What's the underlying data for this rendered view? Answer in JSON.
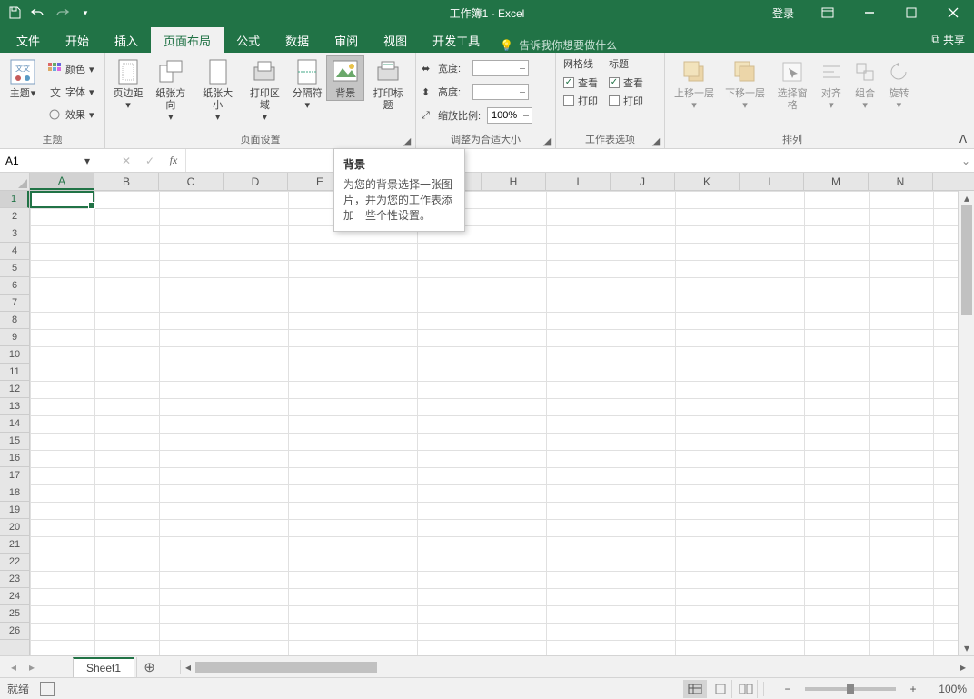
{
  "title": "工作簿1 - Excel",
  "login": "登录",
  "share": "共享",
  "tabs": [
    "文件",
    "开始",
    "插入",
    "页面布局",
    "公式",
    "数据",
    "审阅",
    "视图",
    "开发工具"
  ],
  "active_tab": 3,
  "tell_me": "告诉我你想要做什么",
  "ribbon": {
    "themes": {
      "label": "主题",
      "btn": "主题",
      "colors": "颜色",
      "fonts": "字体",
      "effects": "效果"
    },
    "page_setup": {
      "label": "页面设置",
      "margins": "页边距",
      "orientation": "纸张方向",
      "size": "纸张大小",
      "print_area": "打印区域",
      "breaks": "分隔符",
      "background": "背景",
      "print_titles": "打印标题"
    },
    "scale": {
      "label": "调整为合适大小",
      "width": "宽度:",
      "height": "高度:",
      "scale_lbl": "缩放比例:",
      "scale_val": "100%"
    },
    "sheet_opts": {
      "label": "工作表选项",
      "gridlines": "网格线",
      "headings": "标题",
      "view": "查看",
      "print": "打印"
    },
    "arrange": {
      "label": "排列",
      "bring_forward": "上移一层",
      "send_backward": "下移一层",
      "selection_pane": "选择窗格",
      "align": "对齐",
      "group": "组合",
      "rotate": "旋转"
    }
  },
  "tooltip": {
    "title": "背景",
    "body": "为您的背景选择一张图片，并为您的工作表添加一些个性设置。"
  },
  "name_box": "A1",
  "columns": [
    "A",
    "B",
    "C",
    "D",
    "E",
    "F",
    "G",
    "H",
    "I",
    "J",
    "K",
    "L",
    "M",
    "N"
  ],
  "rows": 26,
  "sheet": "Sheet1",
  "status": "就绪",
  "zoom": "100%"
}
